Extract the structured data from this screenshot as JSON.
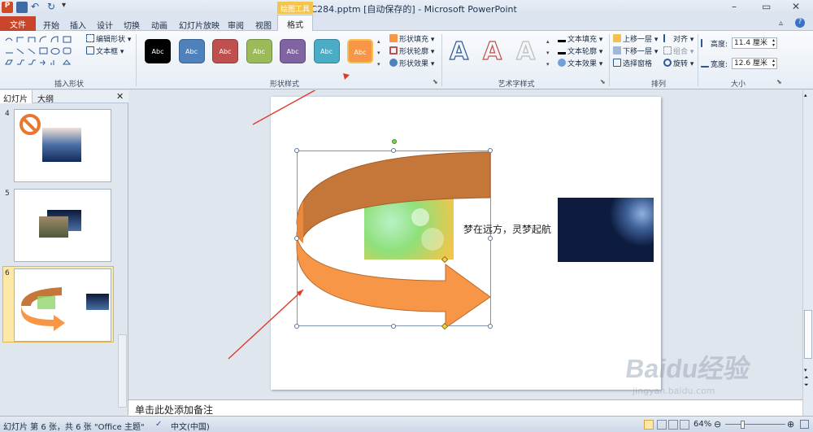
{
  "window": {
    "title": "pptC284.pptm [自动保存的] - Microsoft PowerPoint",
    "controls": [
      "–",
      "▭",
      "✕"
    ]
  },
  "tabs": {
    "file": "文件",
    "items": [
      "开始",
      "插入",
      "设计",
      "切换",
      "动画",
      "幻灯片放映",
      "审阅",
      "视图"
    ],
    "context_header": "绘图工具",
    "format": "格式"
  },
  "ribbon": {
    "insert_shapes": {
      "label": "插入形状",
      "edit_shape": "编辑形状",
      "text_box": "文本框"
    },
    "shape_styles": {
      "label": "形状样式",
      "swatch_text": "Abc",
      "swatch_colors": [
        "#000000",
        "#4f81bd",
        "#c0504d",
        "#9bbb59",
        "#8064a2",
        "#4bacc6",
        "#f79646"
      ],
      "fill": "形状填充",
      "outline": "形状轮廓",
      "effects": "形状效果"
    },
    "wordart": {
      "label": "艺术字样式",
      "fill": "文本填充",
      "outline": "文本轮廓",
      "effects": "文本效果",
      "glyph": "A"
    },
    "arrange": {
      "label": "排列",
      "bring_forward": "上移一层",
      "send_backward": "下移一层",
      "selection_pane": "选择窗格",
      "align": "对齐",
      "group": "组合",
      "rotate": "旋转"
    },
    "size": {
      "label": "大小",
      "height_label": "高度:",
      "height_value": "11.4 厘米",
      "width_label": "宽度:",
      "width_value": "12.6 厘米"
    }
  },
  "left_pane": {
    "tabs": [
      "幻灯片",
      "大纲"
    ],
    "close": "✕",
    "slides": [
      {
        "num": "4"
      },
      {
        "num": "5"
      },
      {
        "num": "6"
      }
    ]
  },
  "slide": {
    "caption": "梦在远方，灵梦起航"
  },
  "notes": {
    "placeholder": "单击此处添加备注"
  },
  "status": {
    "slide_info": "幻灯片 第 6 张，共 6 张",
    "theme": "\"Office 主题\"",
    "language": "中文(中国)",
    "zoom": "64%"
  },
  "watermark": {
    "brand": "Baidu经验",
    "url": "jingyan.baidu.com"
  }
}
